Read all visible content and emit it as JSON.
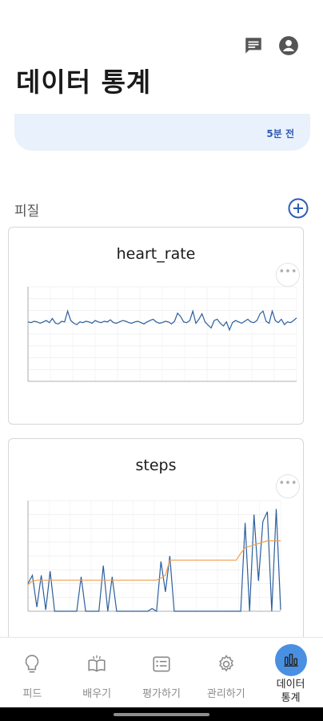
{
  "header": {
    "title": "데이터 통계",
    "icons": [
      "message-icon",
      "account-icon"
    ]
  },
  "status": {
    "time": "5분 전"
  },
  "section": {
    "label": "피질"
  },
  "charts": [
    {
      "title": "heart_rate"
    },
    {
      "title": "steps"
    }
  ],
  "chart_data": [
    {
      "type": "line",
      "title": "heart_rate",
      "ylim": [
        0,
        140
      ],
      "series": [
        {
          "values": [
            88,
            87,
            89,
            88,
            86,
            88,
            90,
            87,
            93,
            86,
            85,
            89,
            88,
            104,
            90,
            86,
            84,
            88,
            87,
            89,
            88,
            86,
            90,
            88,
            87,
            89,
            88,
            91,
            87,
            86,
            88,
            90,
            89,
            87,
            86,
            88,
            89,
            87,
            85,
            88,
            90,
            92,
            88,
            86,
            87,
            89,
            88,
            85,
            89,
            101,
            96,
            88,
            87,
            90,
            104,
            86,
            92,
            100,
            88,
            83,
            79,
            90,
            92,
            86,
            82,
            88,
            76,
            87,
            90,
            88,
            86,
            89,
            92,
            88,
            87,
            90,
            100,
            104,
            89,
            86,
            104,
            90,
            87,
            92,
            84,
            88,
            87,
            90,
            94
          ]
        }
      ]
    },
    {
      "type": "line",
      "title": "steps",
      "ylim": [
        0,
        8000
      ],
      "series": [
        {
          "values": [
            2000,
            2600,
            300,
            2600,
            100,
            2900,
            0,
            0,
            0,
            0,
            0,
            0,
            2500,
            0,
            0,
            0,
            0,
            3300,
            0,
            2500,
            0,
            0,
            0,
            0,
            0,
            0,
            0,
            0,
            200,
            0,
            3600,
            1400,
            4000,
            0,
            0,
            0,
            0,
            0,
            0,
            0,
            0,
            0,
            0,
            0,
            0,
            0,
            0,
            0,
            0,
            6400,
            0,
            7000,
            2200,
            6500,
            7200,
            0,
            7400,
            100
          ]
        },
        {
          "values": [
            1900,
            2200,
            2250,
            2250,
            2250,
            2250,
            2250,
            2250,
            2250,
            2250,
            2250,
            2250,
            2250,
            2250,
            2250,
            2250,
            2250,
            2250,
            2250,
            2250,
            2250,
            2250,
            2250,
            2250,
            2250,
            2250,
            2250,
            2250,
            2250,
            2250,
            2400,
            2600,
            3700,
            3700,
            3700,
            3700,
            3700,
            3700,
            3700,
            3700,
            3700,
            3700,
            3700,
            3700,
            3700,
            3700,
            3700,
            3700,
            4200,
            4600,
            4700,
            4800,
            4900,
            5000,
            5100,
            5100,
            5100,
            5100
          ]
        }
      ]
    }
  ],
  "nav": {
    "items": [
      {
        "label": "피드"
      },
      {
        "label": "배우기"
      },
      {
        "label": "평가하기"
      },
      {
        "label": "관리하기"
      },
      {
        "label": "데이터\n통계"
      }
    ]
  }
}
